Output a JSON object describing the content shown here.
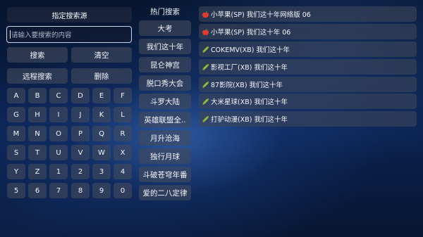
{
  "left_panel": {
    "source_title": "指定搜索源",
    "search_placeholder": "请输入要搜索的内容",
    "search_button": "搜索",
    "clear_button": "清空",
    "remote_search_button": "远程搜索",
    "delete_button": "删除",
    "keys": [
      "A",
      "B",
      "C",
      "D",
      "E",
      "F",
      "G",
      "H",
      "I",
      "J",
      "K",
      "L",
      "M",
      "N",
      "O",
      "P",
      "Q",
      "R",
      "S",
      "T",
      "U",
      "V",
      "W",
      "X",
      "Y",
      "Z",
      "1",
      "2",
      "3",
      "4",
      "5",
      "6",
      "7",
      "8",
      "9",
      "0"
    ]
  },
  "hot": {
    "title": "热门搜索",
    "items": [
      "大考",
      "我们这十年",
      "昆仑神宫",
      "脱口秀大会",
      "斗罗大陆",
      "英雄联盟全..",
      "月升沧海",
      "独行月球",
      "斗破苍穹年番",
      "爱的二八定律"
    ]
  },
  "results": [
    {
      "icon": "apple",
      "text": "小苹果(SP) 我们这十年网络版 06"
    },
    {
      "icon": "apple",
      "text": "小苹果(SP) 我们这十年 06"
    },
    {
      "icon": "cucumber",
      "text": "COKEMV(XB) 我们这十年"
    },
    {
      "icon": "cucumber",
      "text": "影视工厂(XB) 我们这十年"
    },
    {
      "icon": "cucumber",
      "text": "87影院(XB) 我们这十年"
    },
    {
      "icon": "cucumber",
      "text": "大米星球(XB) 我们这十年"
    },
    {
      "icon": "cucumber",
      "text": "打驴动漫(XB) 我们这十年"
    }
  ],
  "colors": {
    "accent_border": "#c8d4ea",
    "button_bg": "#424a5c",
    "apple": "#e23b2e",
    "cucumber": "#8fb83a"
  }
}
